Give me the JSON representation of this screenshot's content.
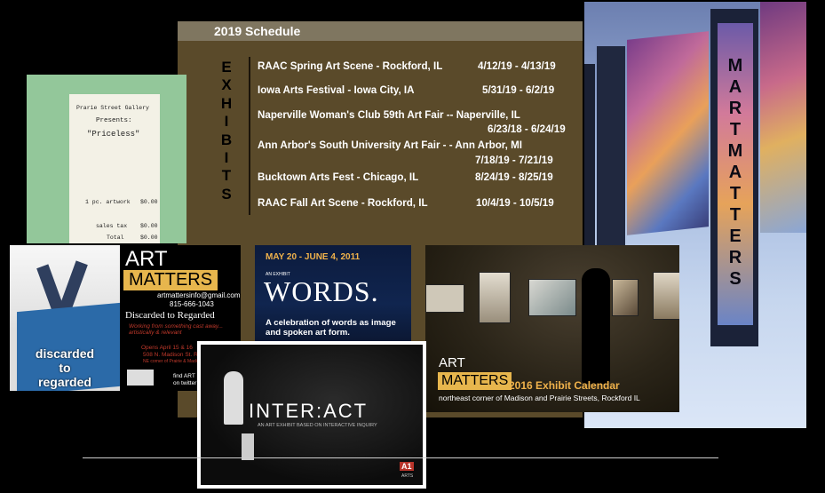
{
  "schedule": {
    "header": "2019 Schedule",
    "vertical_word": "EXHIBITS",
    "events": [
      {
        "name": "RAAC Spring Art Scene - Rockford, IL",
        "dates": "4/12/19 - 4/13/19"
      },
      {
        "name": "Iowa Arts Festival - Iowa City, IA",
        "dates": "5/31/19 - 6/2/19"
      },
      {
        "name": "Naperville Woman's Club 59th Art Fair -- Naperville, IL",
        "dates": "6/23/18 - 6/24/19"
      },
      {
        "name": "Ann Arbor's South University Art Fair - - Ann Arbor, MI",
        "dates": "7/18/19 - 7/21/19"
      },
      {
        "name": "Bucktown Arts Fest - Chicago, IL",
        "dates": "8/24/19 - 8/25/19"
      },
      {
        "name": "RAAC Fall Art Scene - Rockford, IL",
        "dates": "10/4/19 - 10/5/19"
      }
    ]
  },
  "receipt": {
    "line1": "Prarie Street Gallery",
    "line2": "Presents:",
    "line3": "\"Priceless\"",
    "item": "1 pc. artwork",
    "item_price": "$0.00",
    "tax": "sales tax",
    "tax_price": "$0.00",
    "total": "Total",
    "total_price": "$0.00"
  },
  "discarded": {
    "caption": [
      "discarded",
      "to",
      "regarded"
    ],
    "art": "ART",
    "matters": "MATTERS",
    "email": "artmattersinfo@gmail.com",
    "phone": "815-666-1043",
    "title": "Discarded to Regarded",
    "tagline": "Working from something cast away... artistically & relevant",
    "opens": "Opens April 15 & 16",
    "address": "508 N. Madison St. Ro...",
    "corner": "NE corner of Prairie & Madison",
    "find": "find ART",
    "twitter": "on twitter"
  },
  "words": {
    "dates": "MAY 20 - JUNE 4, 2011",
    "kicker": "AN EXHIBIT",
    "title": "WORDS.",
    "subtitle": "A celebration of words as image and spoken art form."
  },
  "gallery": {
    "art": "ART",
    "matters": "MATTERS",
    "calendar": "2016 Exhibit Calendar",
    "address": "northeast corner of Madison and Prairie Streets, Rockford IL"
  },
  "interact": {
    "title": "INTER:ACT",
    "subtitle": "AN ART EXHIBIT BASED ON INTERACTIVE INQUIRY",
    "logo": "A1",
    "logo_sub": "ARTS"
  },
  "photo": {
    "letters": [
      "M",
      "A",
      "R",
      "T",
      "M",
      "A",
      "T",
      "T",
      "E",
      "R",
      "S"
    ]
  },
  "colors": {
    "accent_gold": "#e7b64d",
    "schedule_bg": "#5a4a2a",
    "receipt_bg": "#93c79a"
  }
}
